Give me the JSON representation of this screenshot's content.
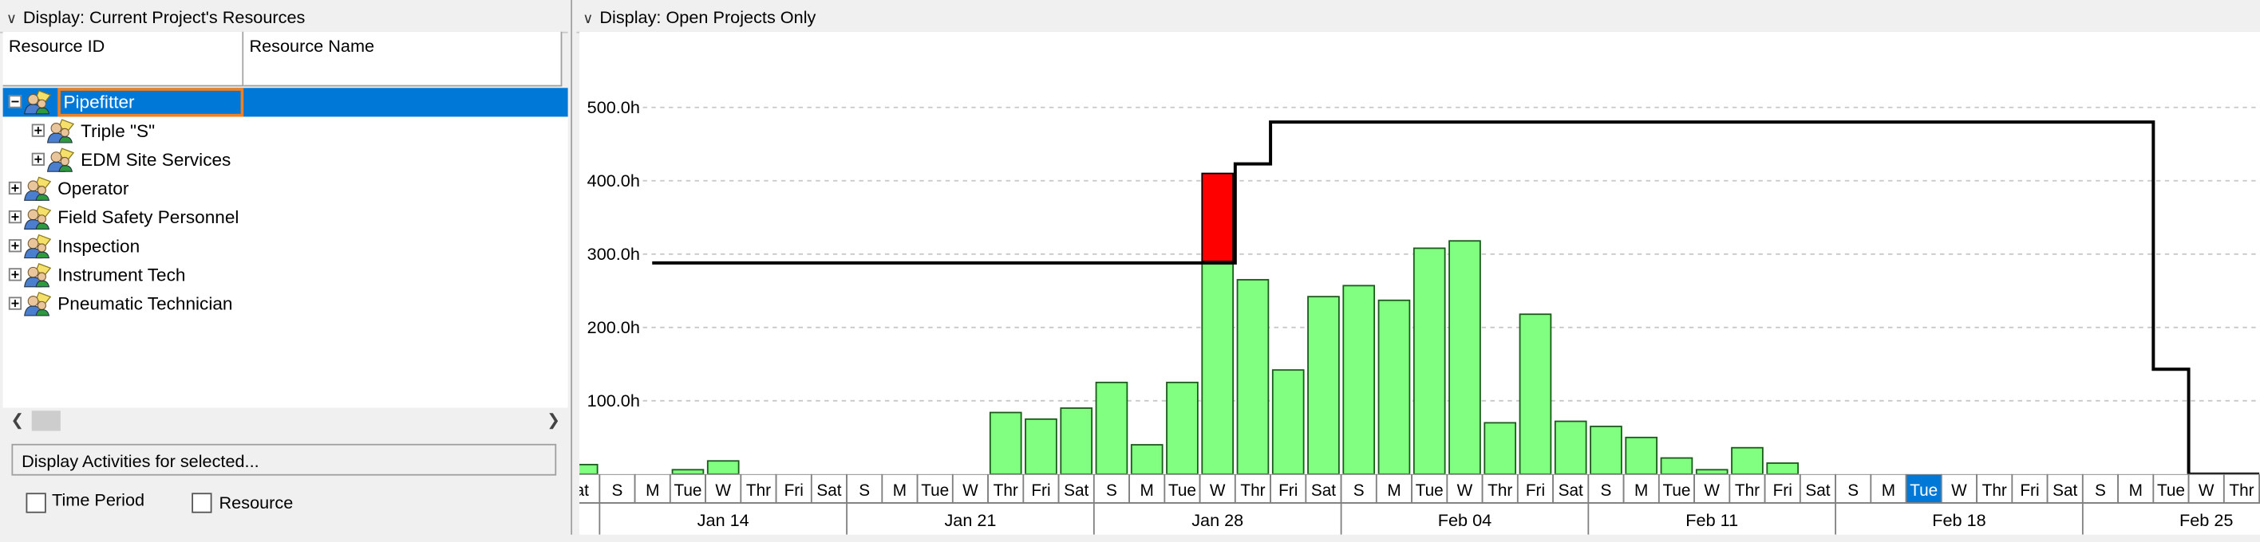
{
  "left_panel": {
    "display_label": "Display: Current Project's Resources",
    "columns": [
      "Resource ID",
      "Resource Name"
    ],
    "tree": [
      {
        "label": "Pipefitter",
        "level": 0,
        "expanded": true,
        "selected": true
      },
      {
        "label": "Triple \"S\"",
        "level": 1,
        "expanded": false,
        "selected": false
      },
      {
        "label": "EDM Site Services",
        "level": 1,
        "expanded": false,
        "selected": false
      },
      {
        "label": "Operator",
        "level": 0,
        "expanded": false,
        "selected": false
      },
      {
        "label": "Field Safety Personnel",
        "level": 0,
        "expanded": false,
        "selected": false
      },
      {
        "label": "Inspection",
        "level": 0,
        "expanded": false,
        "selected": false
      },
      {
        "label": "Instrument Tech",
        "level": 0,
        "expanded": false,
        "selected": false
      },
      {
        "label": "Pneumatic Technician",
        "level": 0,
        "expanded": false,
        "selected": false
      }
    ],
    "activities_label": "Display Activities for selected...",
    "time_period_label": "Time Period",
    "resource_label": "Resource"
  },
  "right_panel": {
    "display_label": "Display: Open Projects Only"
  },
  "chart_data": {
    "type": "bar",
    "y_unit": "h",
    "ylim": [
      0,
      560
    ],
    "y_ticks": [
      "500.0h",
      "400.0h",
      "300.0h",
      "200.0h",
      "100.0h"
    ],
    "y_tick_values": [
      500,
      400,
      300,
      200,
      100
    ],
    "day_labels": [
      "Sat",
      "S",
      "M",
      "Tue",
      "W",
      "Thr",
      "Fri",
      "Sat",
      "S",
      "M",
      "Tue",
      "W",
      "Thr",
      "Fri",
      "Sat",
      "S",
      "M",
      "Tue",
      "W",
      "Thr",
      "Fri",
      "Sat",
      "S",
      "M",
      "Tue",
      "W",
      "Thr",
      "Fri",
      "Sat",
      "S",
      "M",
      "Tue",
      "W",
      "Thr",
      "Fri",
      "Sat",
      "S",
      "M",
      "Tue",
      "W",
      "Thr",
      "Fri",
      "Sat",
      "S",
      "M",
      "Tue",
      "W",
      "Thr"
    ],
    "visible_day_labels": [
      "at",
      "S",
      "M",
      "Tue",
      "W",
      "Thr",
      "Fri",
      "Sat",
      "S",
      "M",
      "Tue",
      "W",
      "Thr",
      "Fri",
      "Sat",
      "S",
      "M",
      "Tue",
      "W",
      "Thr",
      "Fri",
      "Sat",
      "S",
      "M",
      "Tue",
      "W",
      "Thr",
      "Fri",
      "Sat",
      "S",
      "M",
      "Tue",
      "W",
      "Thr",
      "Fri",
      "Sat",
      "S",
      "M",
      "Tue",
      "W",
      "Thr",
      "Fri",
      "Sat",
      "S",
      "M",
      "Tue",
      "W",
      "Thr"
    ],
    "highlighted_day_index": 38,
    "week_labels": [
      "Jan 14",
      "Jan 21",
      "Jan 28",
      "Feb 04",
      "Feb 11",
      "Feb 18",
      "Feb 25"
    ],
    "allocation_values": [
      13,
      0,
      0,
      6,
      18,
      0,
      0,
      0,
      0,
      0,
      0,
      0,
      84,
      75,
      90,
      125,
      40,
      125,
      290,
      265,
      142,
      242,
      257,
      237,
      308,
      318,
      70,
      218,
      72,
      65,
      50,
      22,
      6,
      36,
      15,
      0,
      0,
      0,
      0,
      0,
      0,
      0,
      0,
      0,
      0,
      0,
      0,
      0
    ],
    "overallocation_values": [
      0,
      0,
      0,
      0,
      0,
      0,
      0,
      0,
      0,
      0,
      0,
      0,
      0,
      0,
      0,
      0,
      0,
      0,
      120,
      0,
      0,
      0,
      0,
      0,
      0,
      0,
      0,
      0,
      0,
      0,
      0,
      0,
      0,
      0,
      0,
      0,
      0,
      0,
      0,
      0,
      0,
      0,
      0,
      0,
      0,
      0,
      0,
      0
    ],
    "limit_values": [
      null,
      null,
      288,
      288,
      288,
      288,
      288,
      288,
      288,
      288,
      288,
      288,
      288,
      288,
      288,
      288,
      288,
      288,
      288,
      423,
      480,
      480,
      480,
      480,
      480,
      480,
      480,
      480,
      480,
      480,
      480,
      480,
      480,
      480,
      480,
      480,
      480,
      480,
      480,
      480,
      480,
      480,
      480,
      480,
      480,
      143,
      0,
      0
    ],
    "colors": {
      "allocation": "#80ff80",
      "overallocation": "#ff0000",
      "limit": "#000000",
      "selected": "#0078d7"
    }
  }
}
